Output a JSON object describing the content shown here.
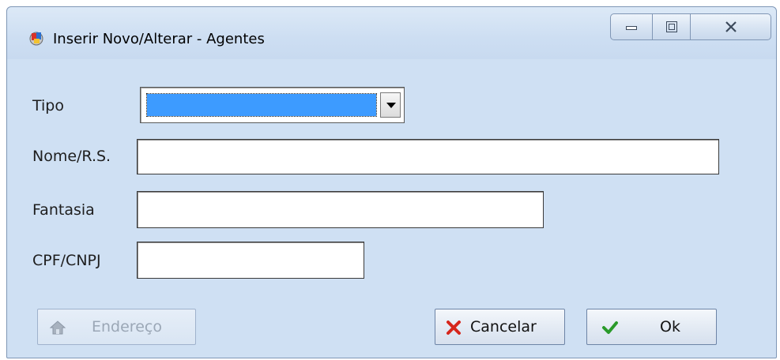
{
  "window": {
    "title": "Inserir Novo/Alterar - Agentes",
    "controls": {
      "minimize": "minimize-icon",
      "maximize": "maximize-icon",
      "close": "close-icon"
    }
  },
  "form": {
    "tipo": {
      "label": "Tipo",
      "value": ""
    },
    "nome": {
      "label": "Nome/R.S.",
      "value": ""
    },
    "fantasia": {
      "label": "Fantasia",
      "value": ""
    },
    "cpf_cnpj": {
      "label": "CPF/CNPJ",
      "value": ""
    }
  },
  "buttons": {
    "endereco": {
      "label": "Endereço",
      "icon": "house-icon",
      "enabled": false
    },
    "cancelar": {
      "label": "Cancelar",
      "icon": "x-icon",
      "enabled": true
    },
    "ok": {
      "label": "Ok",
      "icon": "check-icon",
      "enabled": true
    }
  },
  "colors": {
    "window_bg": "#cfe0f3",
    "select_highlight": "#3d9bff",
    "cancel_icon": "#d6261c",
    "ok_icon": "#2a9a2a"
  }
}
